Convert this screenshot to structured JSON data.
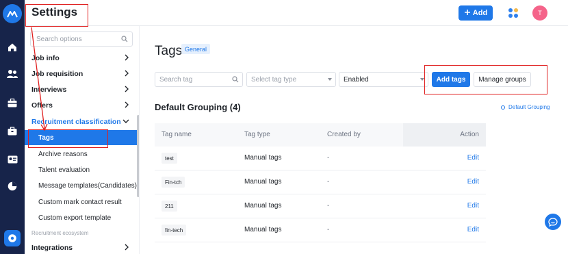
{
  "app": {
    "title": "Settings"
  },
  "header": {
    "add_label": "Add",
    "avatar_initial": "T"
  },
  "rail": {
    "items": [
      "home-icon",
      "people-icon",
      "briefcase-icon",
      "toolbox-icon",
      "id-card-icon",
      "pie-chart-icon",
      "settings-icon"
    ],
    "active": "settings-icon"
  },
  "sidebar": {
    "search_placeholder": "Search options",
    "items": [
      {
        "label": "Job info",
        "chevron": "right"
      },
      {
        "label": "Job requisition",
        "chevron": "right"
      },
      {
        "label": "Interviews",
        "chevron": "right"
      },
      {
        "label": "Offers",
        "chevron": "right"
      },
      {
        "label": "Recruitment classification",
        "chevron": "down"
      }
    ],
    "sub_items": [
      {
        "label": "Tags",
        "active": true
      },
      {
        "label": "Archive reasons"
      },
      {
        "label": "Talent evaluation"
      },
      {
        "label": "Message templates(Candidates)"
      },
      {
        "label": "Custom mark contact result"
      },
      {
        "label": "Custom export template"
      }
    ],
    "section_label": "Recruitment ecosystem",
    "integrations_label": "Integrations"
  },
  "main": {
    "title": "Tags",
    "badge": "General",
    "filters": {
      "search_placeholder": "Search tag",
      "type_placeholder": "Select tag type",
      "status_value": "Enabled"
    },
    "add_tags_label": "Add tags",
    "manage_groups_label": "Manage groups",
    "group_title": "Default Grouping",
    "group_count": "(4)",
    "anchor_label": "Default Grouping",
    "table": {
      "headers": [
        "Tag name",
        "Tag type",
        "Created by",
        "Action"
      ],
      "rows": [
        {
          "name": "test",
          "type": "Manual tags",
          "created_by": "-",
          "action": "Edit"
        },
        {
          "name": "Fin-tch",
          "type": "Manual tags",
          "created_by": "-",
          "action": "Edit"
        },
        {
          "name": "211",
          "type": "Manual tags",
          "created_by": "-",
          "action": "Edit"
        },
        {
          "name": "fin-tech",
          "type": "Manual tags",
          "created_by": "-",
          "action": "Edit"
        }
      ]
    }
  },
  "colors": {
    "brand": "#1f78e8",
    "rail": "#17244a",
    "annotation": "#e02020",
    "avatar": "#f5648a"
  }
}
